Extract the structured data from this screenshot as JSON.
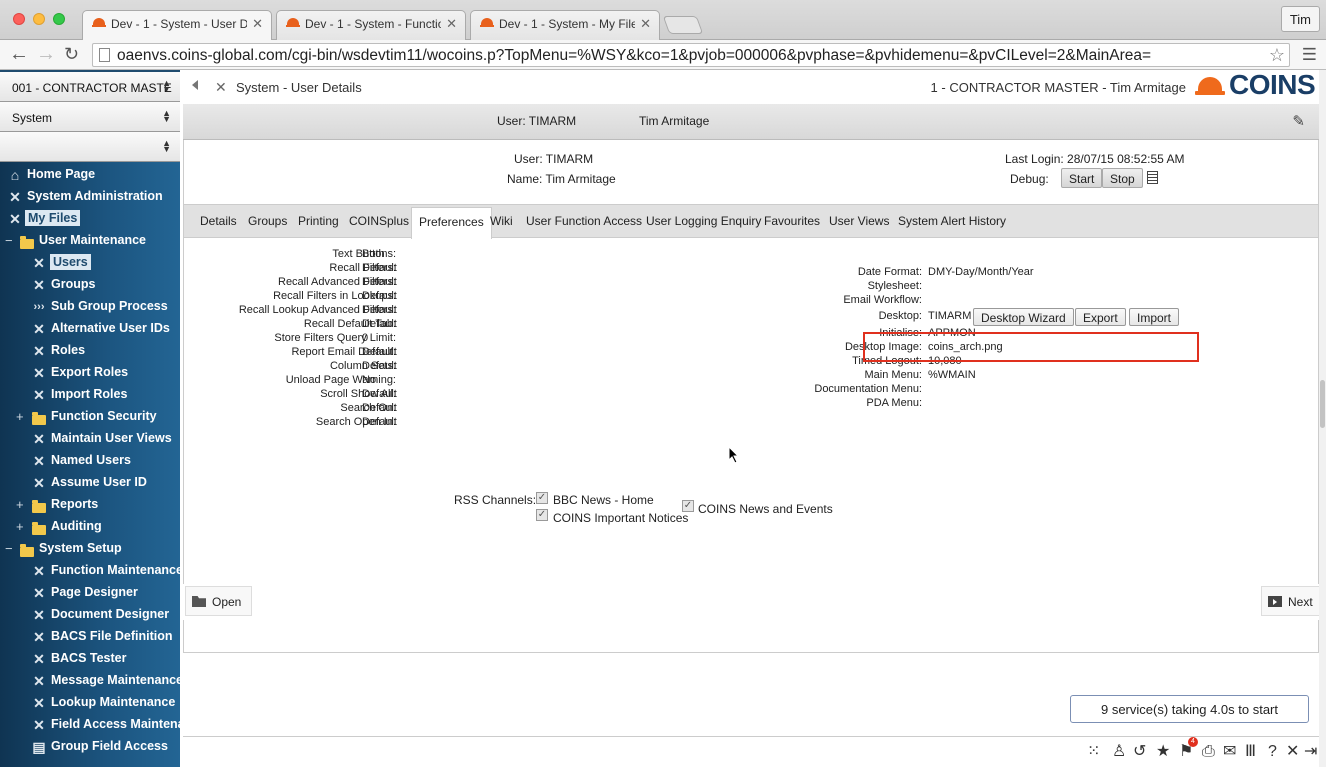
{
  "browser": {
    "tabs": [
      {
        "label": "Dev - 1 - System - User De"
      },
      {
        "label": "Dev - 1 - System - Functio"
      },
      {
        "label": "Dev - 1 - System - My Files"
      }
    ],
    "profile": "Tim",
    "url": "oaenvs.coins-global.com/cgi-bin/wsdevtim11/wocoins.p?TopMenu=%WSY&kco=1&pvjob=000006&pvphase=&pvhidemenu=&pvCILevel=2&MainArea="
  },
  "sidebar": {
    "company_select": "001 - CONTRACTOR MASTE",
    "module_select": "System",
    "third_select": "",
    "items": [
      {
        "label": "Home Page",
        "icon": "home-icon"
      },
      {
        "label": "System Administration",
        "icon": "tools-icon"
      },
      {
        "label": "My Files",
        "icon": "tools-icon"
      },
      {
        "label": "User Maintenance",
        "icon": "folder-icon"
      },
      {
        "label": "Users",
        "icon": "tools-icon"
      },
      {
        "label": "Groups",
        "icon": "tools-icon"
      },
      {
        "label": "Sub Group Process",
        "icon": "process-icon"
      },
      {
        "label": "Alternative User IDs",
        "icon": "tools-icon"
      },
      {
        "label": "Roles",
        "icon": "tools-icon"
      },
      {
        "label": "Export Roles",
        "icon": "tools-icon"
      },
      {
        "label": "Import Roles",
        "icon": "tools-icon"
      },
      {
        "label": "Function Security",
        "icon": "folder-icon"
      },
      {
        "label": "Maintain User Views",
        "icon": "tools-icon"
      },
      {
        "label": "Named Users",
        "icon": "tools-icon"
      },
      {
        "label": "Assume User ID",
        "icon": "tools-icon"
      },
      {
        "label": "Reports",
        "icon": "folder-icon"
      },
      {
        "label": "Auditing",
        "icon": "folder-icon"
      },
      {
        "label": "System Setup",
        "icon": "folder-icon"
      },
      {
        "label": "Function Maintenance",
        "icon": "tools-icon"
      },
      {
        "label": "Page Designer",
        "icon": "tools-icon"
      },
      {
        "label": "Document Designer",
        "icon": "tools-icon"
      },
      {
        "label": "BACS File Definition",
        "icon": "tools-icon"
      },
      {
        "label": "BACS Tester",
        "icon": "tools-icon"
      },
      {
        "label": "Message Maintenance",
        "icon": "tools-icon"
      },
      {
        "label": "Lookup Maintenance",
        "icon": "tools-icon"
      },
      {
        "label": "Field Access Maintenance",
        "icon": "tools-icon"
      },
      {
        "label": "Group Field Access",
        "icon": "grid-icon"
      }
    ]
  },
  "header": {
    "title": "System - User Details",
    "company": "1 - CONTRACTOR MASTER - Tim Armitage",
    "logo_text": "COINS",
    "user_label": "User: TIMARM",
    "user_name": "Tim Armitage"
  },
  "summary": {
    "user": "User: TIMARM",
    "name": "Name: Tim Armitage",
    "last_login": "Last Login: 28/07/15 08:52:55 AM",
    "debug_label": "Debug:",
    "start_label": "Start",
    "stop_label": "Stop"
  },
  "tabs": [
    {
      "label": "Details"
    },
    {
      "label": "Groups"
    },
    {
      "label": "Printing"
    },
    {
      "label": "COINSplus"
    },
    {
      "label": "Preferences"
    },
    {
      "label": "Wiki"
    },
    {
      "label": "User Function Access"
    },
    {
      "label": "User Logging Enquiry"
    },
    {
      "label": "Favourites"
    },
    {
      "label": "User Views"
    },
    {
      "label": "System Alert History"
    }
  ],
  "prefs_left": [
    {
      "label": "Text Buttons:",
      "value": "Both"
    },
    {
      "label": "Recall Filters:",
      "value": "Default"
    },
    {
      "label": "Recall Advanced Filters:",
      "value": "Default"
    },
    {
      "label": "Recall Filters in Lookups:",
      "value": "Default"
    },
    {
      "label": "Recall Lookup Advanced Filters:",
      "value": "Default"
    },
    {
      "label": "Recall Default Tab:",
      "value": "Default"
    },
    {
      "label": "Store Filters Query Limit:",
      "value": "0"
    },
    {
      "label": "Report Email Default:",
      "value": "Default"
    },
    {
      "label": "Column Sets:",
      "value": "Default"
    },
    {
      "label": "Unload Page Warning:",
      "value": "No"
    },
    {
      "label": "Scroll Show All:",
      "value": "Default"
    },
    {
      "label": "Search On:",
      "value": "Default"
    },
    {
      "label": "Search Open In:",
      "value": "Default"
    }
  ],
  "prefs_right": [
    {
      "label": "Date Format:",
      "value": "DMY-Day/Month/Year"
    },
    {
      "label": "Stylesheet:",
      "value": ""
    },
    {
      "label": "Email Workflow:",
      "value": ""
    },
    {
      "label": "Desktop:",
      "value": "TIMARM"
    },
    {
      "label": "Initialise:",
      "value": "APPMON"
    },
    {
      "label": "Desktop Image:",
      "value": "coins_arch.png"
    },
    {
      "label": "Timed Logout:",
      "value": "10,080"
    },
    {
      "label": "Main Menu:",
      "value": "%WMAIN"
    },
    {
      "label": "Documentation Menu:",
      "value": ""
    },
    {
      "label": "PDA Menu:",
      "value": ""
    }
  ],
  "desktop_buttons": {
    "wizard": "Desktop Wizard",
    "export": "Export",
    "import": "Import"
  },
  "rss": {
    "label": "RSS Channels:",
    "channels": [
      {
        "label": "BBC News - Home",
        "checked": true
      },
      {
        "label": "COINS Important Notices",
        "checked": true
      },
      {
        "label": "COINS News and Events",
        "checked": true
      }
    ]
  },
  "footer": {
    "open_label": "Open",
    "next_label": "Next",
    "services": "9 service(s) taking 4.0s to start",
    "notification_count": "4"
  },
  "colors": {
    "sidebar_bg": "#1f4b6e",
    "accent_orange": "#ef6a1c",
    "highlight_red": "#e0301e"
  }
}
